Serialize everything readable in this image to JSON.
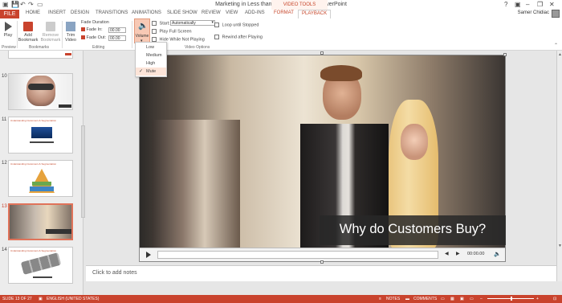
{
  "titlebar": {
    "title": "Marketing in Less than 80 Minutes.pptx - PowerPoint",
    "context_group": "VIDEO TOOLS",
    "window_controls": [
      "?",
      "▣",
      "–",
      "❐",
      "✕"
    ]
  },
  "tabs": {
    "file": "FILE",
    "items": [
      "HOME",
      "INSERT",
      "DESIGN",
      "TRANSITIONS",
      "ANIMATIONS",
      "SLIDE SHOW",
      "REVIEW",
      "VIEW",
      "ADD-INS",
      "FORMAT",
      "PLAYBACK"
    ],
    "active": "PLAYBACK",
    "user": "Samer Chidiac"
  },
  "ribbon": {
    "play": "Play",
    "add_bookmark": "Add Bookmark",
    "remove_bookmark": "Remove Bookmark",
    "trim_video": "Trim Video",
    "fade_duration": "Fade Duration",
    "fade_in": "Fade In:",
    "fade_in_value": "00.00",
    "fade_out": "Fade Out:",
    "fade_out_value": "00.00",
    "volume": "Volume",
    "start": "Start:",
    "start_value": "Automatically",
    "play_full_screen": "Play Full Screen",
    "hide_while_not_playing": "Hide While Not Playing",
    "loop_until_stopped": "Loop until Stopped",
    "rewind_after_playing": "Rewind after Playing",
    "groups": {
      "preview": "Preview",
      "bookmarks": "Bookmarks",
      "editing": "Editing",
      "video_options": "Video Options"
    }
  },
  "volume_menu": {
    "items": [
      "Low",
      "Medium",
      "High",
      "Mute"
    ],
    "selected": "Mute"
  },
  "slides": {
    "numbers": [
      "10",
      "11",
      "12",
      "13",
      "14"
    ],
    "titles": [
      "",
      "Understanding Customers & Segmentation",
      "Understanding Customers & Segmentation",
      "",
      "Understanding Customers & Segmentation"
    ],
    "selected": "13"
  },
  "slide": {
    "caption": "Why do Customers Buy?",
    "time": "00:00.00"
  },
  "notes": {
    "placeholder": "Click to add notes"
  },
  "statusbar": {
    "slide_info": "SLIDE 13 OF 27",
    "language": "ENGLISH (UNITED STATES)",
    "notes": "NOTES",
    "comments": "COMMENTS"
  },
  "colors": {
    "accent": "#C9432D",
    "ribbon_bg": "#FFFFFF",
    "selected_item": "#FCE4D8"
  }
}
